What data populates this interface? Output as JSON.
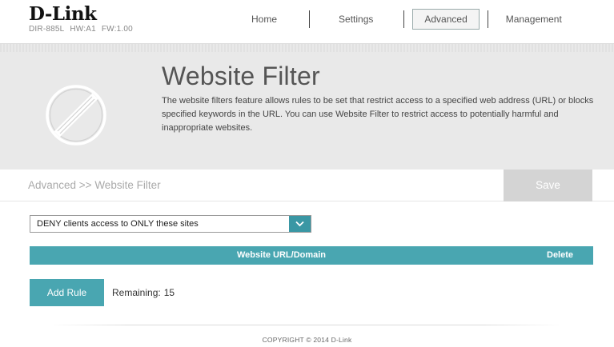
{
  "brand": {
    "name": "D-Link",
    "model": "DIR-885L",
    "hw": "HW:A1",
    "fw": "FW:1.00"
  },
  "nav": {
    "items": [
      {
        "label": "Home"
      },
      {
        "label": "Settings"
      },
      {
        "label": "Advanced",
        "active": true
      },
      {
        "label": "Management"
      }
    ]
  },
  "banner": {
    "title": "Website Filter",
    "description": "The website filters feature allows rules to be set that restrict access to a specified web address (URL) or blocks specified keywords in the URL. You can use Website Filter to restrict access to potentially harmful and inappropriate websites.",
    "icon": "prohibited-icon"
  },
  "breadcrumb": "Advanced >> Website Filter",
  "toolbar": {
    "save_label": "Save"
  },
  "filter_mode": {
    "selected": "DENY clients access to ONLY these sites"
  },
  "table": {
    "columns": [
      "Website URL/Domain",
      "Delete"
    ]
  },
  "rules": {
    "add_label": "Add Rule",
    "remaining_label": "Remaining:",
    "remaining_count": "15"
  },
  "footer": {
    "copyright": "COPYRIGHT © 2014 D-Link"
  },
  "colors": {
    "accent": "#49a6b1",
    "save_disabled": "#d4d4d4",
    "banner_bg": "#e9e9e9"
  }
}
